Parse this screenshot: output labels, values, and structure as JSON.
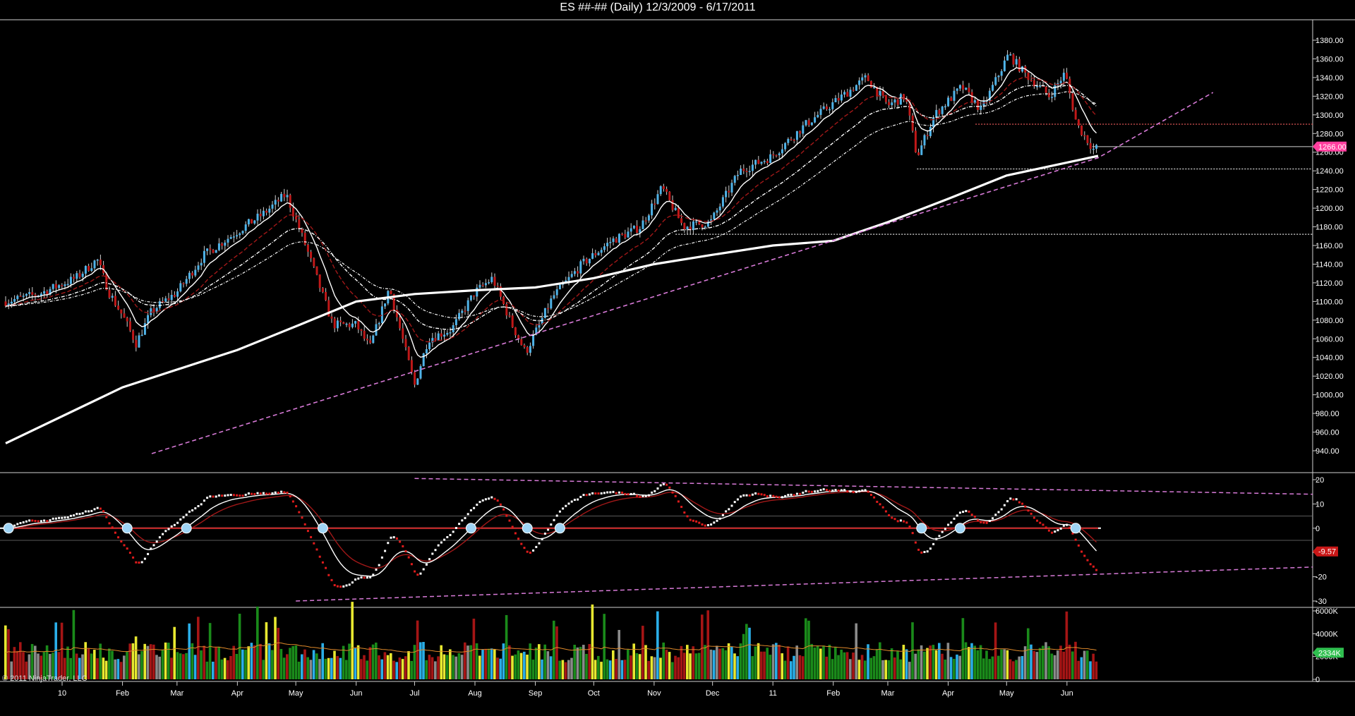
{
  "title": "ES ##-## (Daily)  12/3/2009 - 6/17/2011",
  "copyright": "© 2011 NinjaTrader, LLC",
  "colors": {
    "background": "#000000",
    "up_candle": "#4fb3e8",
    "down_candle": "#c01818",
    "sma_long": "#ffffff",
    "trendline": "#d77ad7",
    "price_marker": "#ff3f9e",
    "osc_marker": "#c91717",
    "volume_marker": "#2fbf4f"
  },
  "chart_data": [
    {
      "type": "line",
      "name": "price",
      "ylim": [
        920,
        1390
      ],
      "yticks": [
        "1380.00",
        "1360.00",
        "1340.00",
        "1320.00",
        "1300.00",
        "1280.00",
        "1260.00",
        "1240.00",
        "1220.00",
        "1200.00",
        "1180.00",
        "1160.00",
        "1140.00",
        "1120.00",
        "1100.00",
        "1080.00",
        "1060.00",
        "1040.00",
        "1020.00",
        "1000.00",
        "980.00",
        "960.00",
        "940.00"
      ],
      "x_tick_labels": [
        "10",
        "Feb",
        "Mar",
        "Apr",
        "May",
        "Jun",
        "Jul",
        "Aug",
        "Sep",
        "Oct",
        "Nov",
        "Dec",
        "11",
        "Feb",
        "Mar",
        "Apr",
        "May",
        "Jun"
      ],
      "last_price_label": "1266.00",
      "close_path": [
        [
          "2009-12-03",
          1100
        ],
        [
          "2009-12-20",
          1108
        ],
        [
          "2010-01-08",
          1125
        ],
        [
          "2010-01-19",
          1145
        ],
        [
          "2010-01-25",
          1110
        ],
        [
          "2010-02-01",
          1085
        ],
        [
          "2010-02-08",
          1055
        ],
        [
          "2010-02-16",
          1090
        ],
        [
          "2010-03-01",
          1110
        ],
        [
          "2010-03-15",
          1150
        ],
        [
          "2010-04-01",
          1175
        ],
        [
          "2010-04-15",
          1195
        ],
        [
          "2010-04-26",
          1215
        ],
        [
          "2010-05-06",
          1160
        ],
        [
          "2010-05-20",
          1075
        ],
        [
          "2010-06-01",
          1075
        ],
        [
          "2010-06-08",
          1050
        ],
        [
          "2010-06-18",
          1115
        ],
        [
          "2010-07-01",
          1010
        ],
        [
          "2010-07-08",
          1060
        ],
        [
          "2010-07-20",
          1070
        ],
        [
          "2010-08-01",
          1110
        ],
        [
          "2010-08-10",
          1125
        ],
        [
          "2010-08-20",
          1075
        ],
        [
          "2010-08-27",
          1045
        ],
        [
          "2010-09-10",
          1105
        ],
        [
          "2010-09-25",
          1140
        ],
        [
          "2010-10-10",
          1165
        ],
        [
          "2010-10-25",
          1180
        ],
        [
          "2010-11-05",
          1222
        ],
        [
          "2010-11-16",
          1180
        ],
        [
          "2010-11-30",
          1185
        ],
        [
          "2010-12-15",
          1240
        ],
        [
          "2010-12-31",
          1255
        ],
        [
          "2011-01-18",
          1290
        ],
        [
          "2011-02-18",
          1340
        ],
        [
          "2011-03-01",
          1310
        ],
        [
          "2011-03-10",
          1320
        ],
        [
          "2011-03-16",
          1255
        ],
        [
          "2011-03-25",
          1300
        ],
        [
          "2011-04-08",
          1330
        ],
        [
          "2011-04-18",
          1305
        ],
        [
          "2011-05-02",
          1365
        ],
        [
          "2011-05-10",
          1345
        ],
        [
          "2011-05-23",
          1320
        ],
        [
          "2011-05-31",
          1345
        ],
        [
          "2011-06-06",
          1290
        ],
        [
          "2011-06-15",
          1262
        ],
        [
          "2011-06-17",
          1266
        ]
      ],
      "sma_200": [
        [
          "2009-12-03",
          948
        ],
        [
          "2010-02-01",
          1008
        ],
        [
          "2010-04-01",
          1048
        ],
        [
          "2010-05-03",
          1075
        ],
        [
          "2010-06-01",
          1100
        ],
        [
          "2010-07-01",
          1108
        ],
        [
          "2010-08-01",
          1112
        ],
        [
          "2010-09-01",
          1115
        ],
        [
          "2010-10-01",
          1125
        ],
        [
          "2010-11-01",
          1140
        ],
        [
          "2010-12-01",
          1150
        ],
        [
          "2011-01-01",
          1160
        ],
        [
          "2011-02-01",
          1165
        ],
        [
          "2011-03-01",
          1185
        ],
        [
          "2011-04-01",
          1210
        ],
        [
          "2011-05-01",
          1235
        ],
        [
          "2011-06-17",
          1256
        ]
      ],
      "trendline": [
        [
          "2010-02-16",
          937
        ],
        [
          "2011-06-17",
          1254
        ],
        [
          "2011-08-15",
          1324
        ]
      ],
      "horizontal_levels": [
        1290,
        1266,
        1242,
        1172
      ]
    },
    {
      "type": "line",
      "name": "oscillator",
      "ylim": [
        -30,
        22
      ],
      "yticks": [
        "20",
        "10",
        "0",
        "-10",
        "-20",
        "-30"
      ],
      "last_value_label": "-9.57"
    },
    {
      "type": "bar",
      "name": "volume",
      "ylim": [
        0,
        6000
      ],
      "yticks": [
        "6000K",
        "4000K",
        "2000K",
        "0"
      ],
      "last_value_label": "2334K"
    }
  ]
}
